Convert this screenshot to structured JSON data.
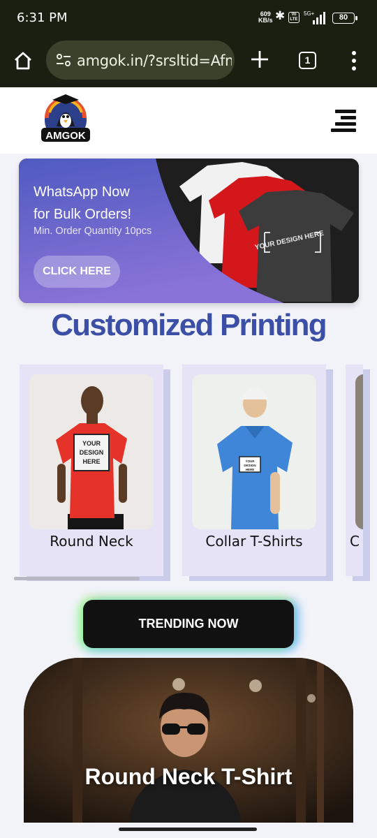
{
  "status_bar": {
    "time": "6:31 PM",
    "net_rate_value": "609",
    "net_rate_unit": "KB/s",
    "network": "5G+",
    "battery": "80"
  },
  "browser": {
    "url": "amgok.in/?srsltid=Afm",
    "tab_count": "1"
  },
  "header": {
    "logo_text": "AMGOK"
  },
  "banner": {
    "line1": "WhatsApp Now",
    "line2": "for Bulk Orders!",
    "subtitle": "Min. Order Quantity 10pcs",
    "cta": "CLICK HERE",
    "shirt_print": "YOUR DESIGN HERE"
  },
  "section_title": "Customized Printing",
  "categories": [
    {
      "label": "Round Neck",
      "print": "YOUR DESIGN HERE"
    },
    {
      "label": "Collar T-Shirts",
      "print": "YOUR DESIGN HERE"
    },
    {
      "label": "C"
    }
  ],
  "trending_button": "TRENDING NOW",
  "hero_caption": "Round Neck T-Shirt",
  "colors": {
    "accent_blue": "#3b4fa6",
    "banner_purple": "#7b6fd6",
    "card_bg": "#e6e3f6"
  }
}
